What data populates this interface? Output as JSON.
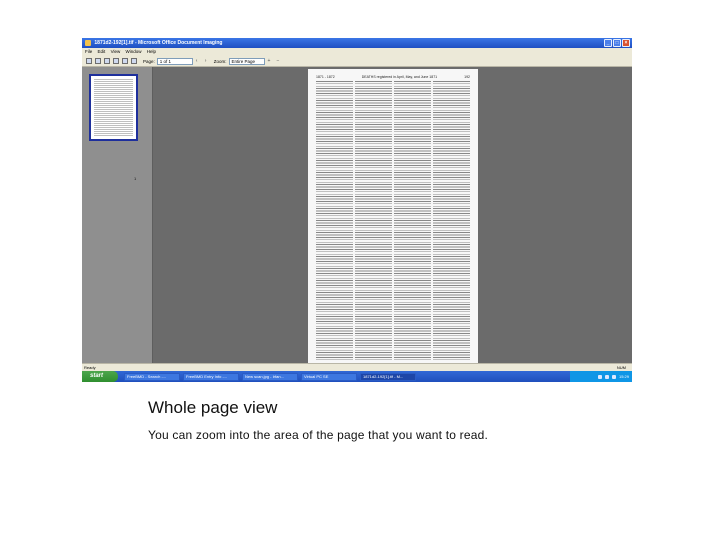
{
  "window": {
    "title": "1871d2-192[1].tif - Microsoft Office Document Imaging",
    "minimize_glyph": "_",
    "maximize_glyph": "□",
    "close_glyph": "×"
  },
  "menu": [
    "File",
    "Edit",
    "View",
    "Window",
    "Help"
  ],
  "toolbar": {
    "page_label": "Page:",
    "page_value": "1 of 1",
    "zoom_label": "Zoom:",
    "zoom_value": "Entire Page"
  },
  "thumbnail": {
    "number": "1"
  },
  "document": {
    "header_left": "1871 - 1872",
    "header_center": "DEATHS registered in April, May, and June 1871",
    "header_right": "192"
  },
  "statusbar": {
    "left": "Ready",
    "right": "NUM"
  },
  "taskbar": {
    "start": "start",
    "tasks": [
      "FreeBMD - Search -...",
      "FreeBMD Entry Info -...",
      "New scan.jpg - Irfan...",
      "Virtual PC SE",
      "1871d2-192[1].tif - M..."
    ],
    "clock": "15:29"
  },
  "slide": {
    "heading": "Whole page view",
    "caption": "You can zoom into the area of the page that you want to read."
  }
}
